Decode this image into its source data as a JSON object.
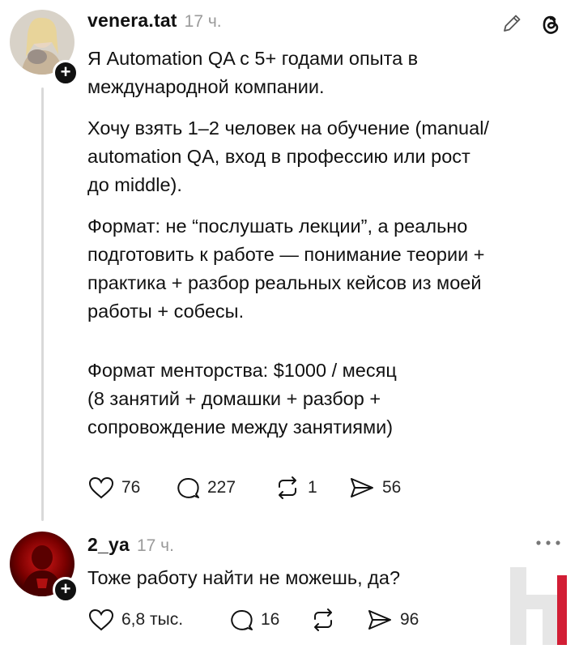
{
  "post": {
    "username": "venera.tat",
    "time": "17 ч.",
    "paragraphs": [
      "Я Automation QA с 5+ годами опыта в\nмеждународной компании.",
      "Хочу взять 1–2 человек на обучение (manual/\nautomation QA, вход в профессию или рост\nдо middle).",
      "Формат: не “послушать лекции”, а реально\nподготовить к работе — понимание теории +\nпрактика + разбор реальных кейсов из моей\nработы + собесы.",
      "Формат менторства: $1000 / месяц\n(8 занятий + домашки + разбор +\nсопровождение между занятиями)"
    ],
    "stats": {
      "likes": "76",
      "comments": "227",
      "reposts": "1",
      "shares": "56"
    }
  },
  "reply": {
    "username": "2_ya",
    "time": "17 ч.",
    "text": "Тоже работу найти не можешь, да?",
    "stats": {
      "likes": "6,8 тыс.",
      "comments": "16",
      "shares": "96"
    }
  },
  "icons": {
    "edit": "pencil-icon",
    "threads": "threads-logo-icon",
    "more": "more-dots-icon",
    "like": "heart-icon",
    "comment": "comment-bubble-icon",
    "repost": "repost-icon",
    "share": "share-send-icon"
  },
  "colors": {
    "text": "#111111",
    "muted": "#9a9a9a",
    "thread_line": "#d9d9d9"
  }
}
